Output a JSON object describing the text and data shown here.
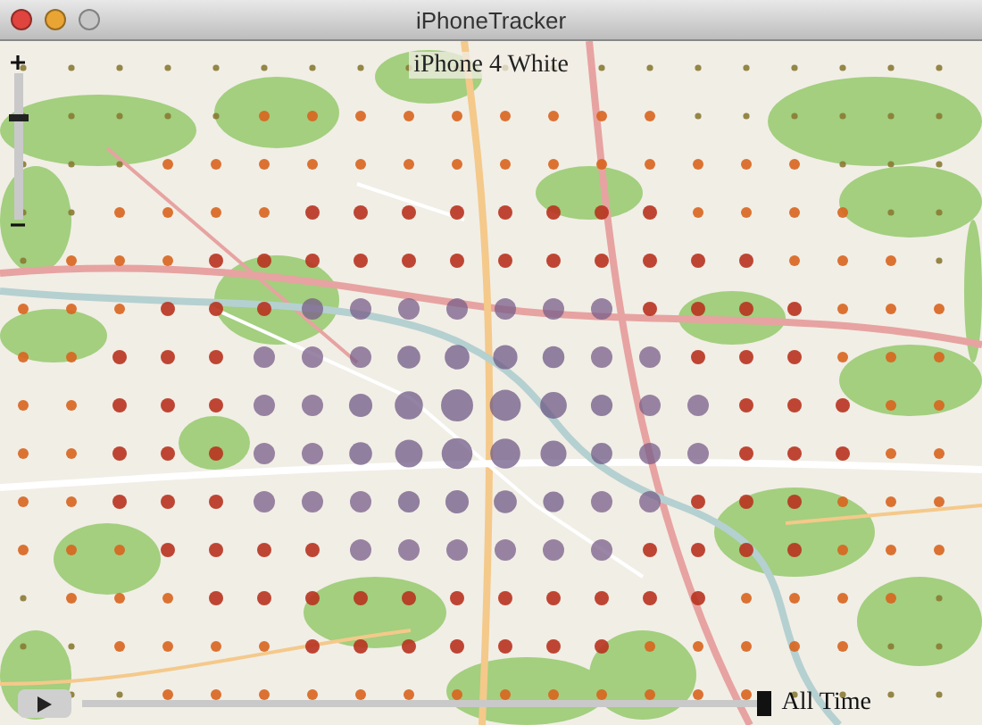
{
  "window": {
    "title": "iPhoneTracker"
  },
  "device_label": "iPhone 4 White",
  "zoom_slider": {
    "level": 0.7
  },
  "timeline": {
    "level": 1,
    "label": "All Time"
  }
}
